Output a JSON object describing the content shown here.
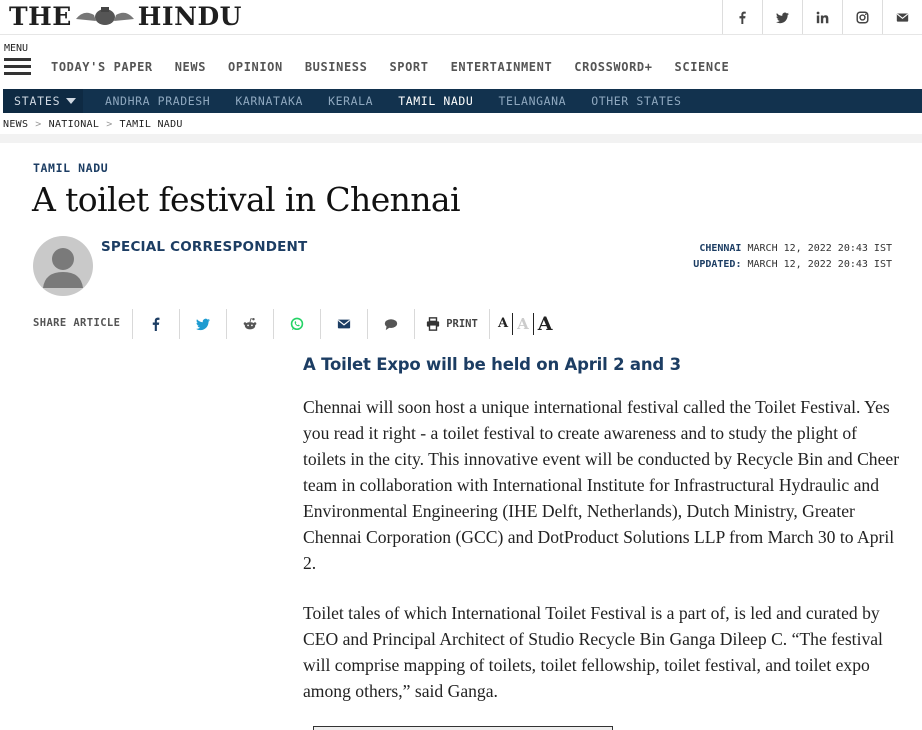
{
  "site": {
    "logo_left": "THE",
    "logo_right": "HINDU"
  },
  "social": [
    {
      "name": "facebook",
      "icon": "facebook-icon"
    },
    {
      "name": "twitter",
      "icon": "twitter-icon"
    },
    {
      "name": "linkedin",
      "icon": "linkedin-icon"
    },
    {
      "name": "instagram",
      "icon": "instagram-icon"
    },
    {
      "name": "email",
      "icon": "mail-icon"
    }
  ],
  "nav": {
    "menu_label": "MENU",
    "items": [
      "TODAY'S PAPER",
      "NEWS",
      "OPINION",
      "BUSINESS",
      "SPORT",
      "ENTERTAINMENT",
      "CROSSWORD+",
      "SCIENCE"
    ]
  },
  "states": {
    "button_label": "STATES",
    "items": [
      "ANDHRA PRADESH",
      "KARNATAKA",
      "KERALA",
      "TAMIL NADU",
      "TELANGANA",
      "OTHER STATES"
    ],
    "active": "TAMIL NADU"
  },
  "breadcrumb": [
    "NEWS",
    "NATIONAL",
    "TAMIL NADU"
  ],
  "article": {
    "section": "TAMIL NADU",
    "headline": "A toilet festival in Chennai",
    "author": "SPECIAL CORRESPONDENT",
    "dateline_city": "CHENNAI",
    "published": "MARCH 12, 2022 20:43 IST",
    "updated_label": "UPDATED:",
    "updated": "MARCH 12, 2022 20:43 IST",
    "subhead": "A Toilet Expo will be held on April 2 and 3",
    "paragraphs": [
      "Chennai will soon host a unique international festival called the Toilet Festival. Yes you read it right - a toilet festival to create awareness and to study the plight of toilets in the city. This innovative event will be conducted by Recycle Bin and Cheer team in collaboration with International Institute for Infrastructural Hydraulic and Environmental Engineering (IHE Delft, Netherlands), Dutch Ministry, Greater Chennai Corporation (GCC) and DotProduct Solutions LLP from March 30 to April 2.",
      "Toilet tales of which International Toilet Festival is a part of, is led and curated by CEO and Principal Architect of Studio Recycle Bin Ganga Dileep C. “The festival will comprise mapping of toilets, toilet fellowship, toilet festival, and toilet expo among others,” said Ganga."
    ]
  },
  "share": {
    "label": "SHARE ARTICLE",
    "print_label": "PRINT",
    "font_sizes": [
      "A",
      "A",
      "A"
    ]
  },
  "colors": {
    "brand_navy": "#12324e",
    "link_navy": "#1c3d63",
    "whatsapp": "#25d366"
  }
}
